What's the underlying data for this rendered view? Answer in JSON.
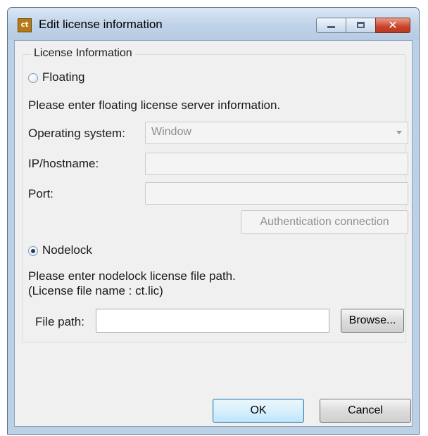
{
  "window": {
    "title": "Edit license information",
    "app_icon_text": "ct"
  },
  "license_group": {
    "legend": "License Information",
    "floating": {
      "label": "Floating",
      "selected": false,
      "instructions": "Please enter floating license server information.",
      "os_label": "Operating system:",
      "os_value": "Window",
      "ip_label": "IP/hostname:",
      "ip_value": "",
      "port_label": "Port:",
      "port_value": "",
      "auth_button": "Authentication connection"
    },
    "nodelock": {
      "label": "Nodelock",
      "selected": true,
      "instructions_line1": "Please enter nodelock license file path.",
      "instructions_line2": "(License file name : ct.lic)",
      "file_path_label": "File path:",
      "file_path_value": "",
      "browse_button": "Browse..."
    }
  },
  "footer": {
    "ok_label": "OK",
    "cancel_label": "Cancel"
  }
}
